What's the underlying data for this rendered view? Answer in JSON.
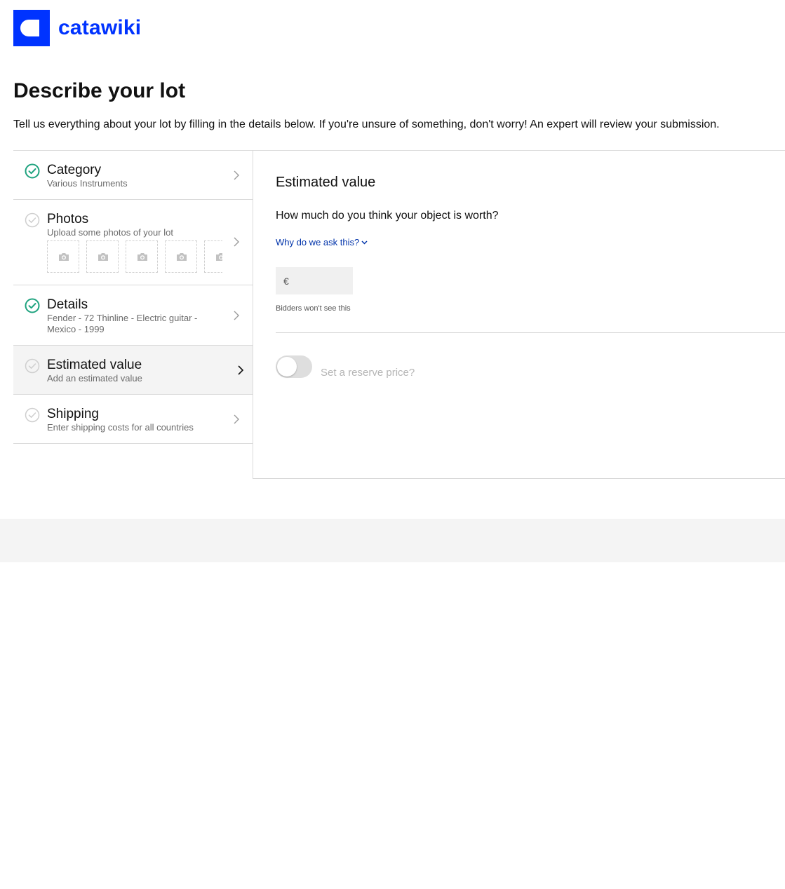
{
  "brand": {
    "name": "catawiki",
    "color": "#0033ff"
  },
  "page": {
    "title": "Describe your lot",
    "intro": "Tell us everything about your lot by filling in the details below. If you're unsure of something, don't worry! An expert will review your submission."
  },
  "steps": [
    {
      "title": "Category",
      "subtitle": "Various Instruments",
      "status": "complete",
      "icon": "check-circle-icon"
    },
    {
      "title": "Photos",
      "subtitle": "Upload some photos of your lot",
      "status": "incomplete",
      "icon": "check-circle-outline-icon",
      "photo_slots": 5
    },
    {
      "title": "Details",
      "subtitle_line1": "Fender - 72 Thinline - Electric guitar -",
      "subtitle_line2": "Mexico - 1999",
      "status": "complete",
      "icon": "check-circle-icon"
    },
    {
      "title": "Estimated value",
      "subtitle": "Add an estimated value",
      "status": "active",
      "icon": "check-circle-outline-icon"
    },
    {
      "title": "Shipping",
      "subtitle": "Enter shipping costs for all countries",
      "status": "incomplete",
      "icon": "check-circle-outline-icon"
    }
  ],
  "panel": {
    "title": "Estimated value",
    "question": "How much do you think your object is worth?",
    "why_link": "Why do we ask this?",
    "currency": "€",
    "value": "",
    "hint": "Bidders won't see this",
    "reserve_label": "Set a reserve price?",
    "reserve_enabled": false
  },
  "colors": {
    "complete": "#1fa37f",
    "incomplete": "#cfcfcf",
    "link": "#0033aa"
  }
}
